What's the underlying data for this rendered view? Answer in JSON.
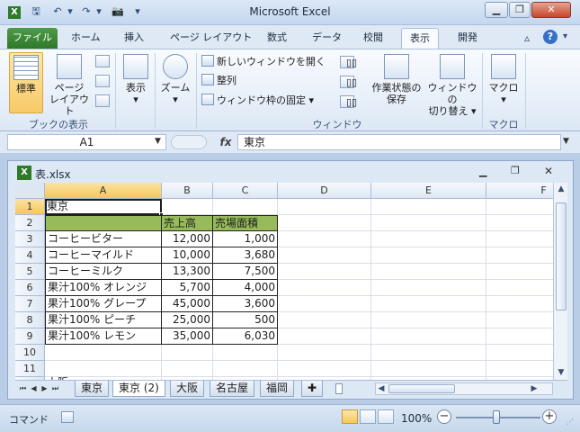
{
  "app": {
    "title": "Microsoft Excel"
  },
  "ribbon_tabs": [
    {
      "label": "ファイル"
    },
    {
      "label": "ホーム"
    },
    {
      "label": "挿入"
    },
    {
      "label": "ページ レイアウト"
    },
    {
      "label": "数式"
    },
    {
      "label": "データ"
    },
    {
      "label": "校閲"
    },
    {
      "label": "表示"
    },
    {
      "label": "開発"
    }
  ],
  "ribbon": {
    "workbook_views": {
      "normal": "標準",
      "page_layout_1": "ページ",
      "page_layout_2": "レイアウト",
      "group": "ブックの表示"
    },
    "show": {
      "label": "表示"
    },
    "zoom": {
      "label": "ズーム"
    },
    "window": {
      "new_window": "新しいウィンドウを開く",
      "arrange": "整列",
      "freeze": "ウィンドウ枠の固定",
      "save_workspace_1": "作業状態の",
      "save_workspace_2": "保存",
      "switch_1": "ウィンドウの",
      "switch_2": "切り替え",
      "group": "ウィンドウ"
    },
    "macros": {
      "label": "マクロ",
      "group": "マクロ"
    }
  },
  "formula_bar": {
    "name_box": "A1",
    "fx": "fx",
    "value": "東京"
  },
  "workbook": {
    "title": "表.xlsx"
  },
  "sheet": {
    "columns": [
      "A",
      "B",
      "C",
      "D",
      "E",
      "F"
    ],
    "row_numbers": [
      "1",
      "2",
      "3",
      "4",
      "5",
      "6",
      "7",
      "8",
      "9",
      "10",
      "11"
    ],
    "a1": "東京",
    "table_headers": [
      "",
      "売上高",
      "売場面積"
    ],
    "rows": [
      [
        "コーヒービター",
        "12,000",
        "1,000"
      ],
      [
        "コーヒーマイルド",
        "10,000",
        "3,680"
      ],
      [
        "コーヒーミルク",
        "13,300",
        "7,500"
      ],
      [
        "果汁100% オレンジ",
        "5,700",
        "4,000"
      ],
      [
        "果汁100% グレープ",
        "45,000",
        "3,600"
      ],
      [
        "果汁100% ピーチ",
        "25,000",
        "500"
      ],
      [
        "果汁100% レモン",
        "35,000",
        "6,030"
      ]
    ],
    "partial_row_text": "大阪"
  },
  "sheet_tabs": [
    {
      "label": "東京"
    },
    {
      "label": "東京 (2)",
      "active": true
    },
    {
      "label": "大阪"
    },
    {
      "label": "名古屋"
    },
    {
      "label": "福岡"
    }
  ],
  "status_bar": {
    "mode": "コマンド",
    "zoom": "100%"
  },
  "colors": {
    "accent_file_tab": "#2e7a2a",
    "table_header_fill": "#97bb5b",
    "selection": "#f5c75b"
  }
}
